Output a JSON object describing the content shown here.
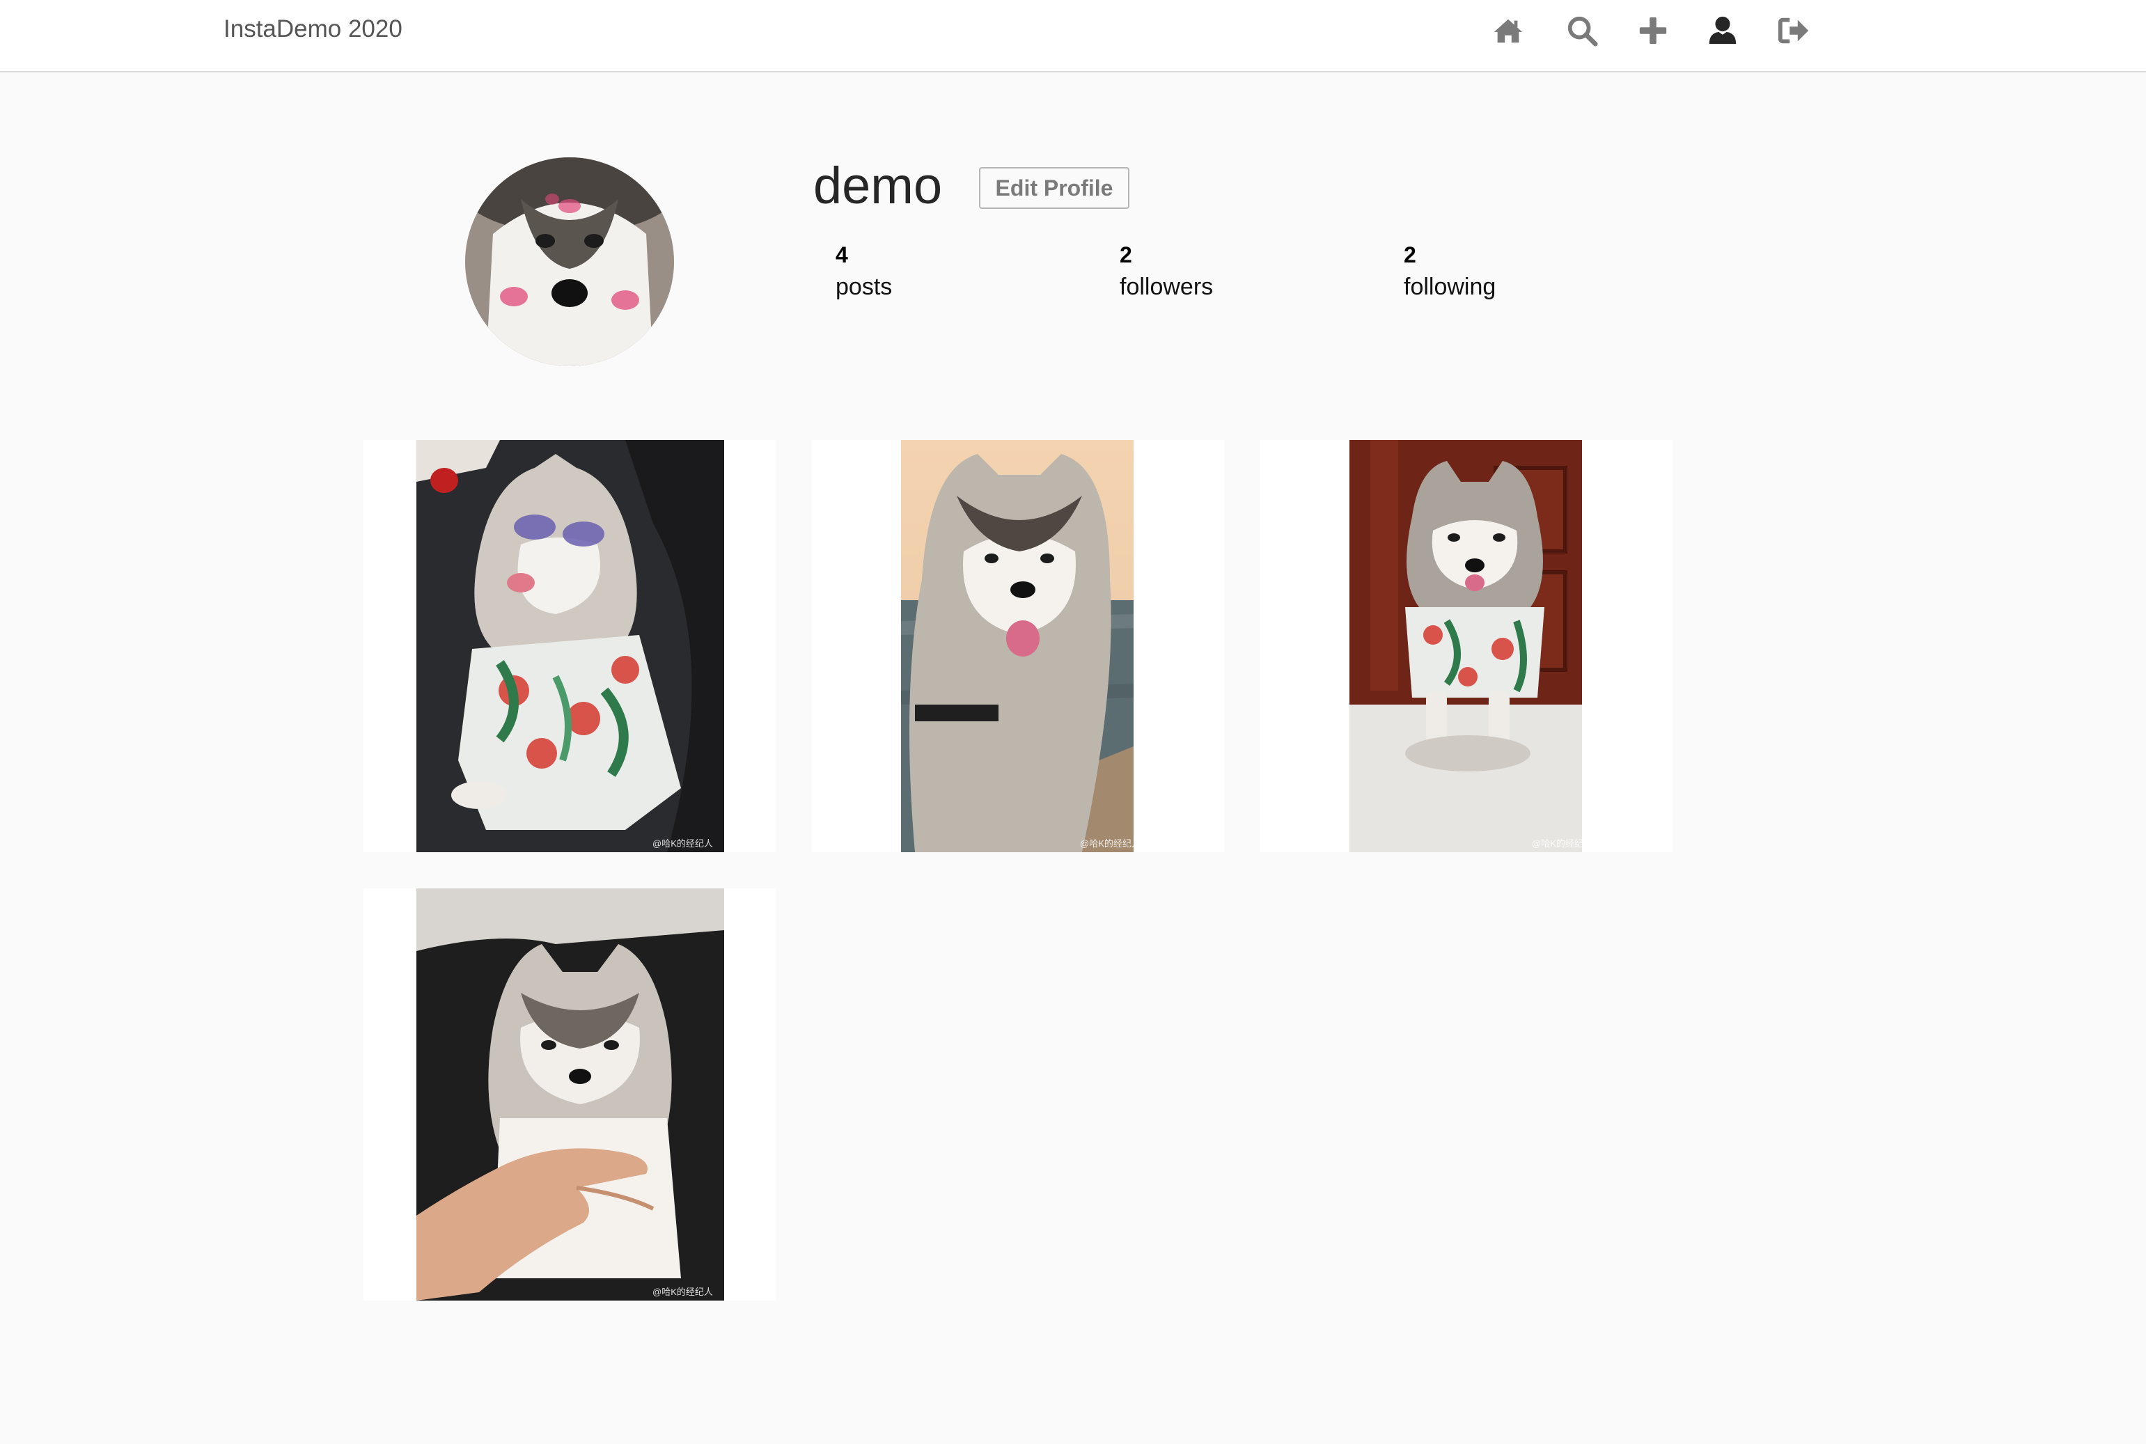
{
  "nav": {
    "brand": "InstaDemo 2020",
    "icons": [
      "home-icon",
      "search-icon",
      "plus-icon",
      "user-icon",
      "sign-out-icon"
    ]
  },
  "profile": {
    "username": "demo",
    "edit_button": "Edit Profile",
    "stats": {
      "posts": {
        "count": "4",
        "label": "posts"
      },
      "followers": {
        "count": "2",
        "label": "followers"
      },
      "following": {
        "count": "2",
        "label": "following"
      }
    }
  },
  "posts": [
    {
      "alt": "husky in sunglasses and floral shirt in car seat",
      "watermark": "@哈K的经纪人"
    },
    {
      "alt": "husky sitting by the water at sunset",
      "watermark": "@哈K的经纪人"
    },
    {
      "alt": "husky in floral shirt by a wooden door",
      "watermark": "@哈K的经纪人"
    },
    {
      "alt": "husky puppy being held",
      "watermark": "@哈K的经纪人"
    }
  ],
  "colors": {
    "background": "#fafafa",
    "nav_icon": "#7a7a7a",
    "active_icon": "#262626"
  }
}
